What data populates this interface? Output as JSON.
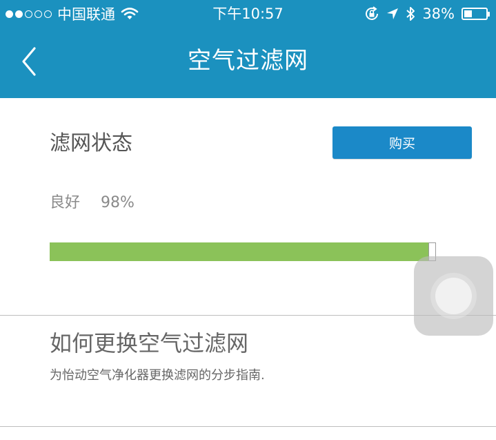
{
  "status_bar": {
    "carrier": "中国联通",
    "time": "下午10:57",
    "battery_text": "38%",
    "battery_level": 0.38,
    "signal_bars_filled": 2,
    "signal_bars_total": 5
  },
  "nav": {
    "title": "空气过滤网"
  },
  "filter_status": {
    "heading": "滤网状态",
    "buy_label": "购买",
    "state_label": "良好",
    "percent_text": "98%",
    "percent_value": 98
  },
  "guide": {
    "title": "如何更换空气过滤网",
    "description": "为怡动空气净化器更换滤网的分步指南."
  },
  "colors": {
    "nav_bg": "#1b91bf",
    "button_bg": "#1b89c8",
    "progress_fill": "#8bc259"
  },
  "icons": [
    "signal-dots-icon",
    "wifi-icon",
    "rotation-lock-icon",
    "location-arrow-icon",
    "bluetooth-icon",
    "battery-icon",
    "back-chevron-icon",
    "assistive-touch-icon"
  ]
}
